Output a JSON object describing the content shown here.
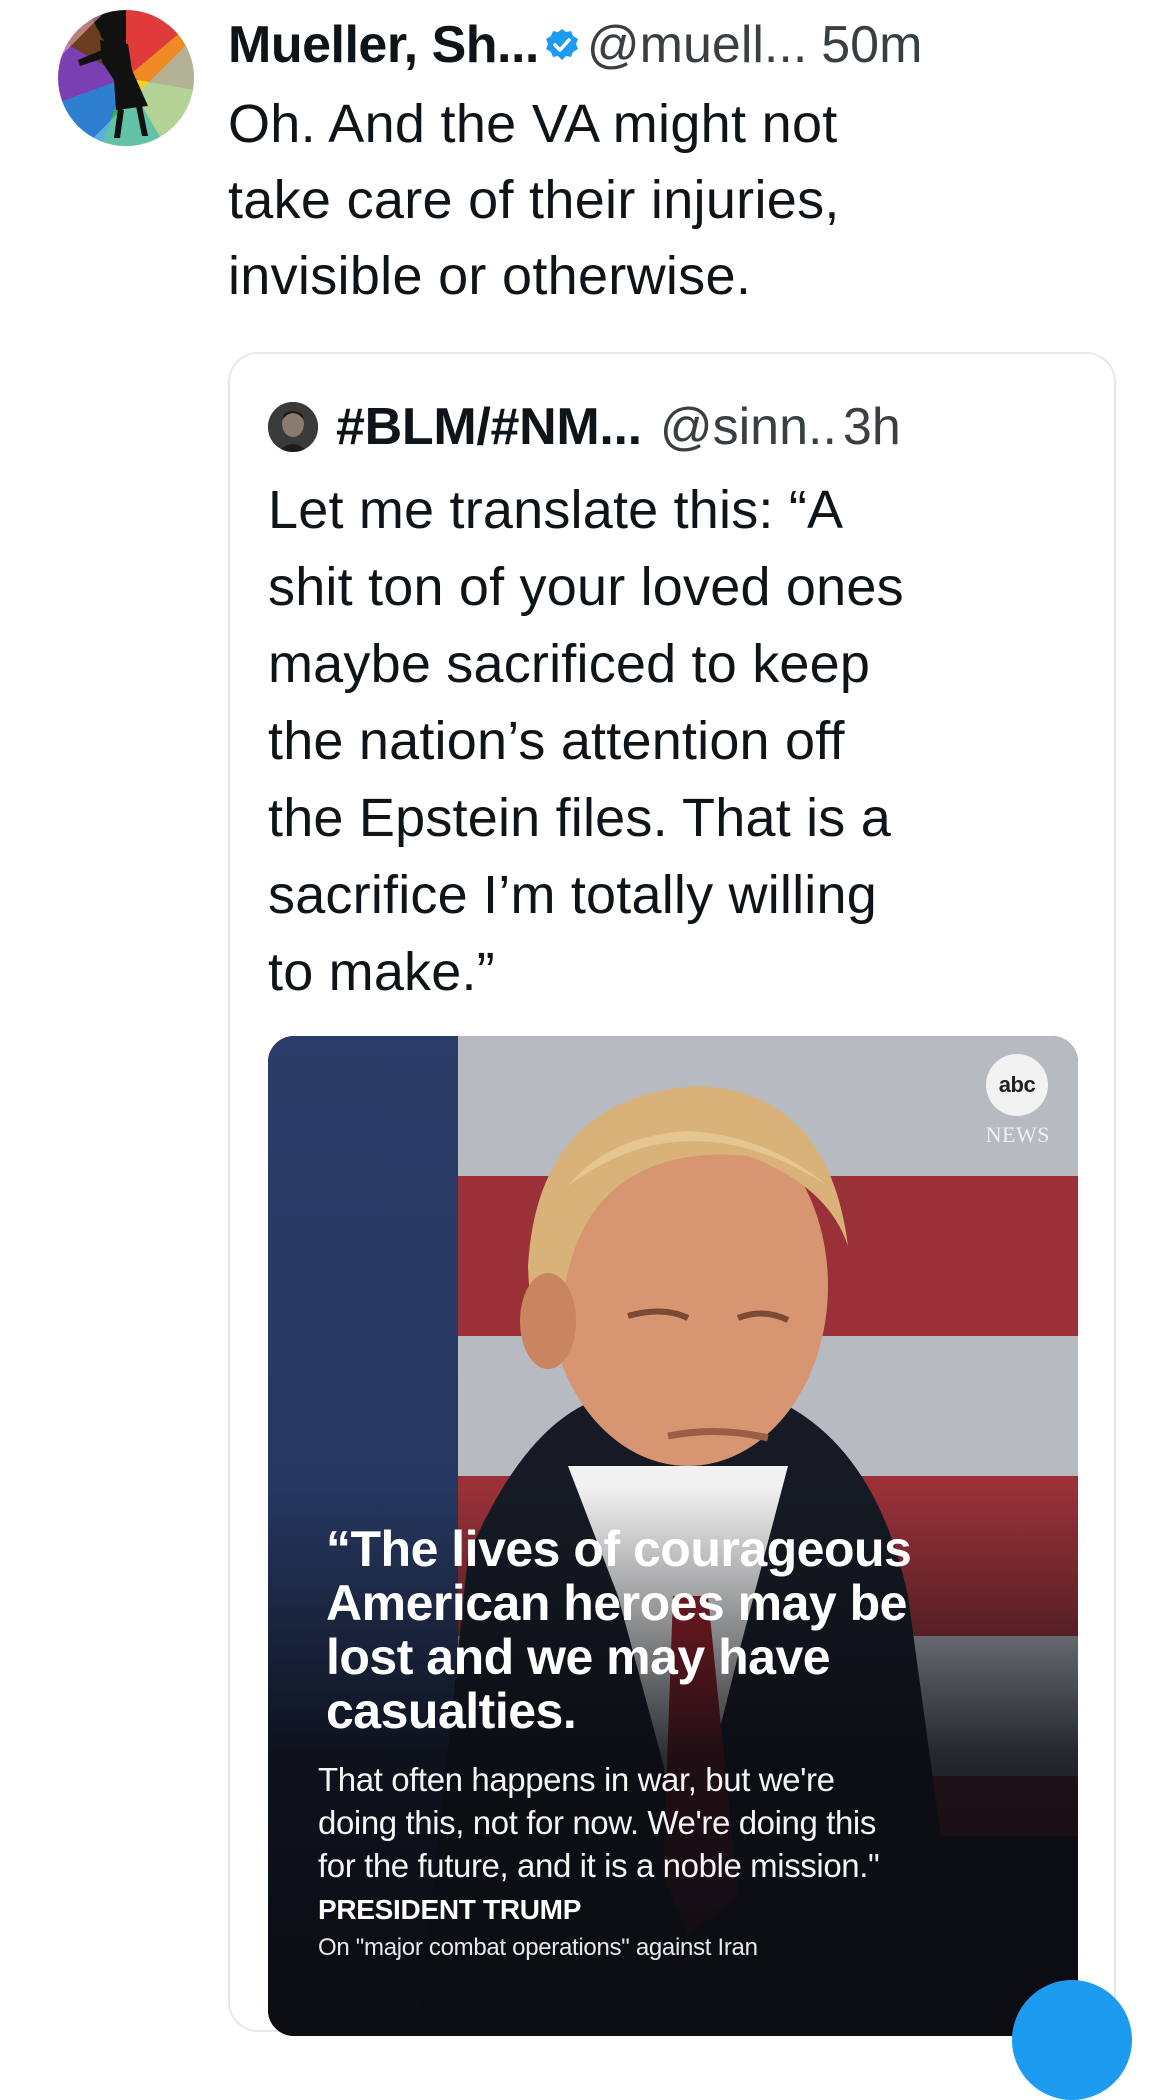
{
  "post": {
    "author_name": "Mueller, Sh...",
    "handle": "@muell...",
    "time": "50m",
    "text": "Oh. And the VA might not\ntake care of their injuries,\ninvisible or otherwise."
  },
  "quoted_post": {
    "author_name": "#BLM/#NM...",
    "handle": "@sinn..",
    "time": "3h",
    "text": "Let me translate this: “A\nshit ton of your loved ones\nmaybe sacrificed to keep\nthe nation’s attention off\nthe Epstein files. That is a\nsacrifice I’m totally willing\nto make.”"
  },
  "media": {
    "logo_text": "abc",
    "logo_sub": "NEWS",
    "headline": "“The lives of courageous\nAmerican heroes may be\nlost and we may have\ncasualties.",
    "subtext": "That often happens in war, but we're\ndoing this, not for now. We're doing this\nfor the future, and it is a noble mission.\"",
    "attribution": "PRESIDENT TRUMP",
    "attribution_sub": "On \"major combat operations\" against Iran"
  },
  "colors": {
    "verified_badge": "#1d9bf0",
    "accent": "#1d9bf0"
  }
}
